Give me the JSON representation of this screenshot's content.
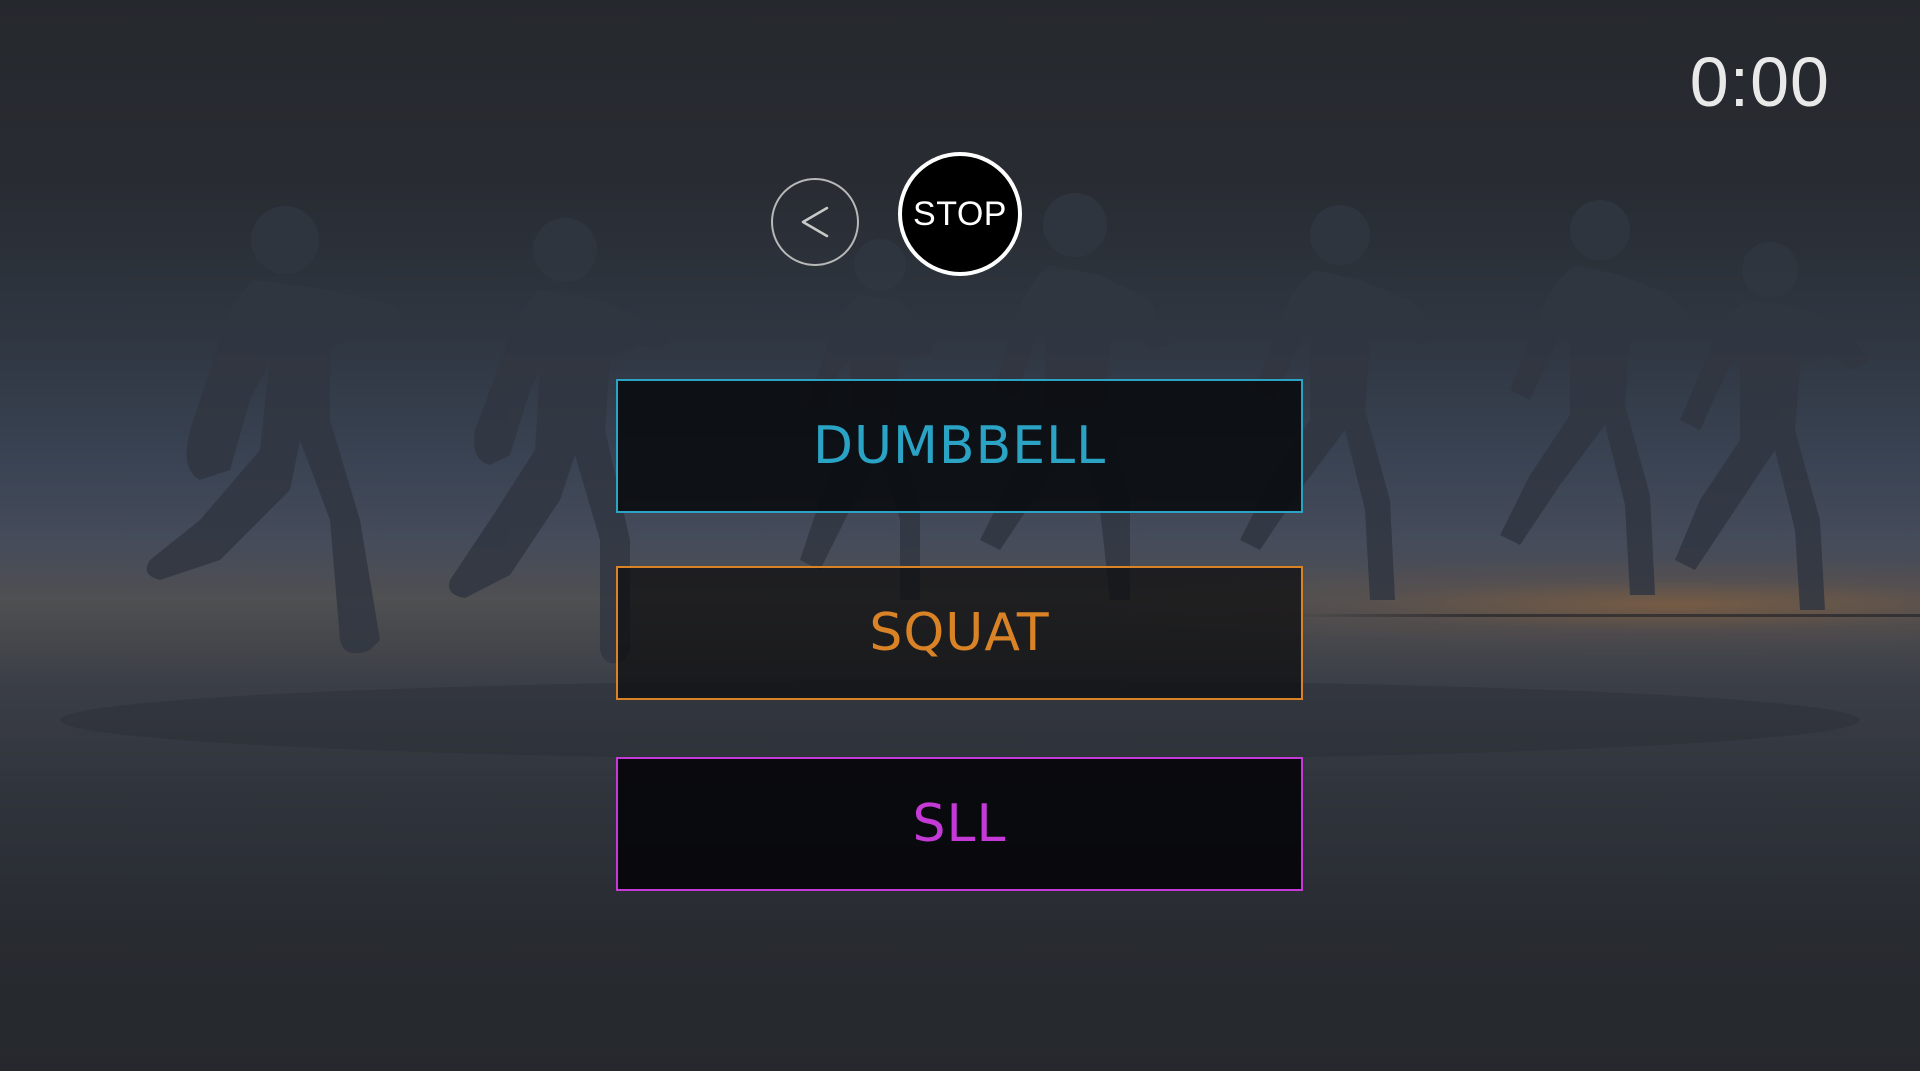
{
  "timer": {
    "value": "0:00"
  },
  "controls": {
    "back_icon": "chevron-left-icon",
    "stop_label": "STOP"
  },
  "options": [
    {
      "label": "DUMBBELL",
      "color": "#2aa3c5"
    },
    {
      "label": "SQUAT",
      "color": "#d98326"
    },
    {
      "label": "SLL",
      "color": "#c53ad6"
    }
  ],
  "background": {
    "description_icon": "runners-silhouette-background",
    "sky_color": "#2b2e33",
    "horizon_accent": "#d68c46"
  }
}
